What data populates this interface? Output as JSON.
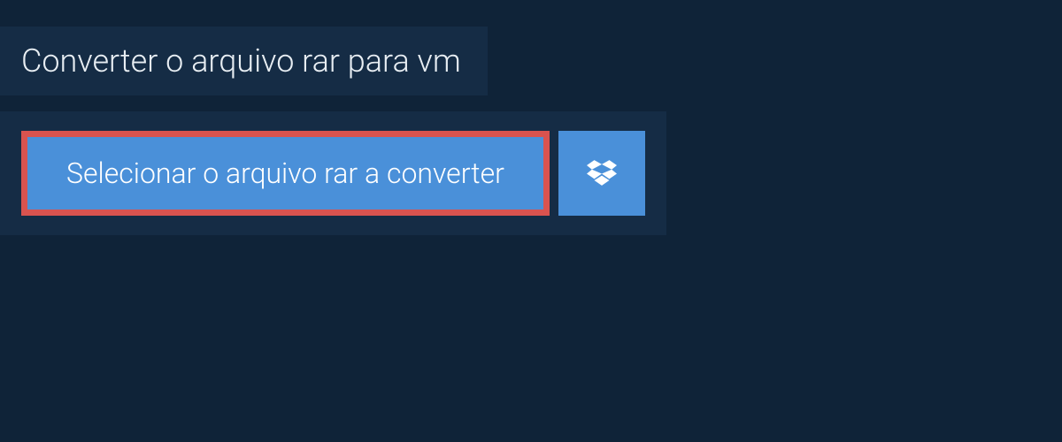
{
  "header": {
    "title": "Converter o arquivo rar para vm"
  },
  "upload": {
    "select_label": "Selecionar o arquivo rar a converter"
  }
}
